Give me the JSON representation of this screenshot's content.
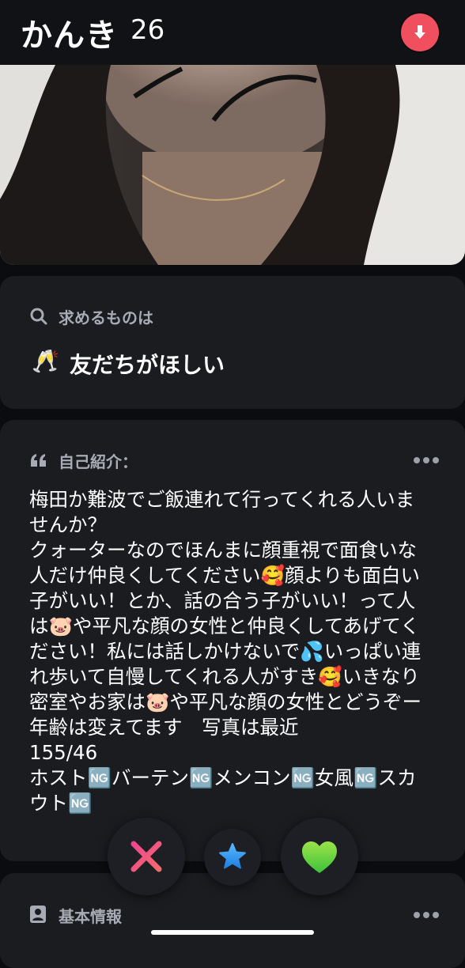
{
  "profile": {
    "name": "かんき",
    "age": "26"
  },
  "header": {
    "download_icon": "arrow-down-icon",
    "accent_color": "#ef4f5e"
  },
  "looking_for": {
    "label": "求めるものは",
    "icon": "search-icon",
    "emoji": "🥂",
    "value": "友だちがほしい"
  },
  "bio": {
    "label": "自己紹介：",
    "icon": "quote-icon",
    "menu_icon": "more-dots-icon",
    "text": "梅田か難波でご飯連れて行ってくれる人いませんか？\nクォーターなのでほんまに顔重視で面食いな人だけ仲良くしてください🥰顔よりも面白い子がいい！とか、話の合う子がいい！って人は🐷や平凡な顔の女性と仲良くしてあげてください！私には話しかけないで💦いっぱい連れ歩いて自慢してくれる人がすき🥰いきなり密室やお家は🐷や平凡な顔の女性とどうぞー\n年齢は変えてます　写真は最近\n155/46\nホスト🆖バーテン🆖メンコン🆖女風🆖スカウト🆖"
  },
  "basic_info": {
    "label": "基本情報",
    "icon": "profile-card-icon",
    "menu_icon": "more-dots-icon"
  },
  "actions": {
    "nope_icon": "close-icon",
    "super_like_icon": "star-icon",
    "like_icon": "heart-icon",
    "colors": {
      "nope": "#f0468f",
      "super_like": "#2f9cf4",
      "like": "#6fd43c"
    }
  }
}
